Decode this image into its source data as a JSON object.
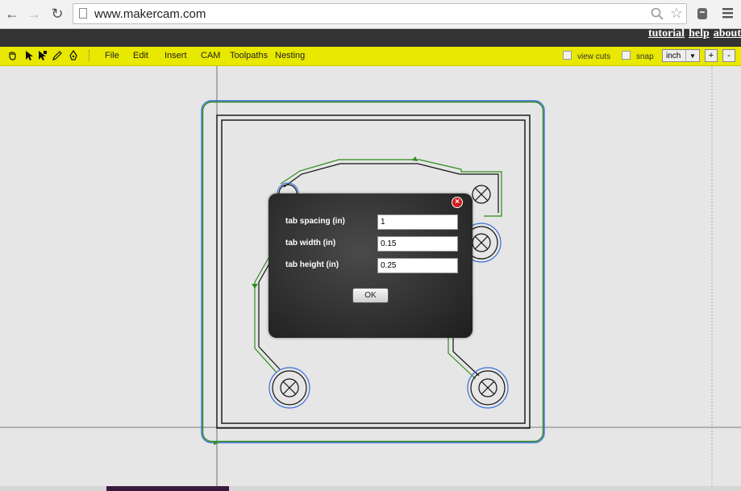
{
  "browser": {
    "url": "www.makercam.com",
    "back_icon": "back-arrow-icon",
    "forward_icon": "forward-arrow-icon",
    "reload_icon": "reload-icon",
    "menu_icon": "hamburger-menu-icon"
  },
  "topbar": {
    "links": [
      "tutorial",
      "help",
      "about"
    ]
  },
  "toolbar": {
    "tools": [
      "hand-tool-icon",
      "pointer-tool-icon",
      "node-tool-icon",
      "pencil-tool-icon",
      "pen-tool-icon"
    ],
    "menus": [
      "File",
      "Edit",
      "Insert",
      "CAM",
      "Toolpaths",
      "Nesting"
    ],
    "view_cuts_label": "view cuts",
    "snap_label": "snap",
    "unit_value": "inch",
    "zoom_in_label": "+",
    "zoom_out_label": "-",
    "accent_color": "#e8e800"
  },
  "dialog": {
    "fields": [
      {
        "label": "tab spacing (in)",
        "value": "1"
      },
      {
        "label": "tab width (in)",
        "value": "0.15"
      },
      {
        "label": "tab height (in)",
        "value": "0.25"
      }
    ],
    "ok_label": "OK"
  },
  "colors": {
    "toolpath_green": "#2f8a1e",
    "outline_blue": "#3a6fd8",
    "part_black": "#111111"
  }
}
